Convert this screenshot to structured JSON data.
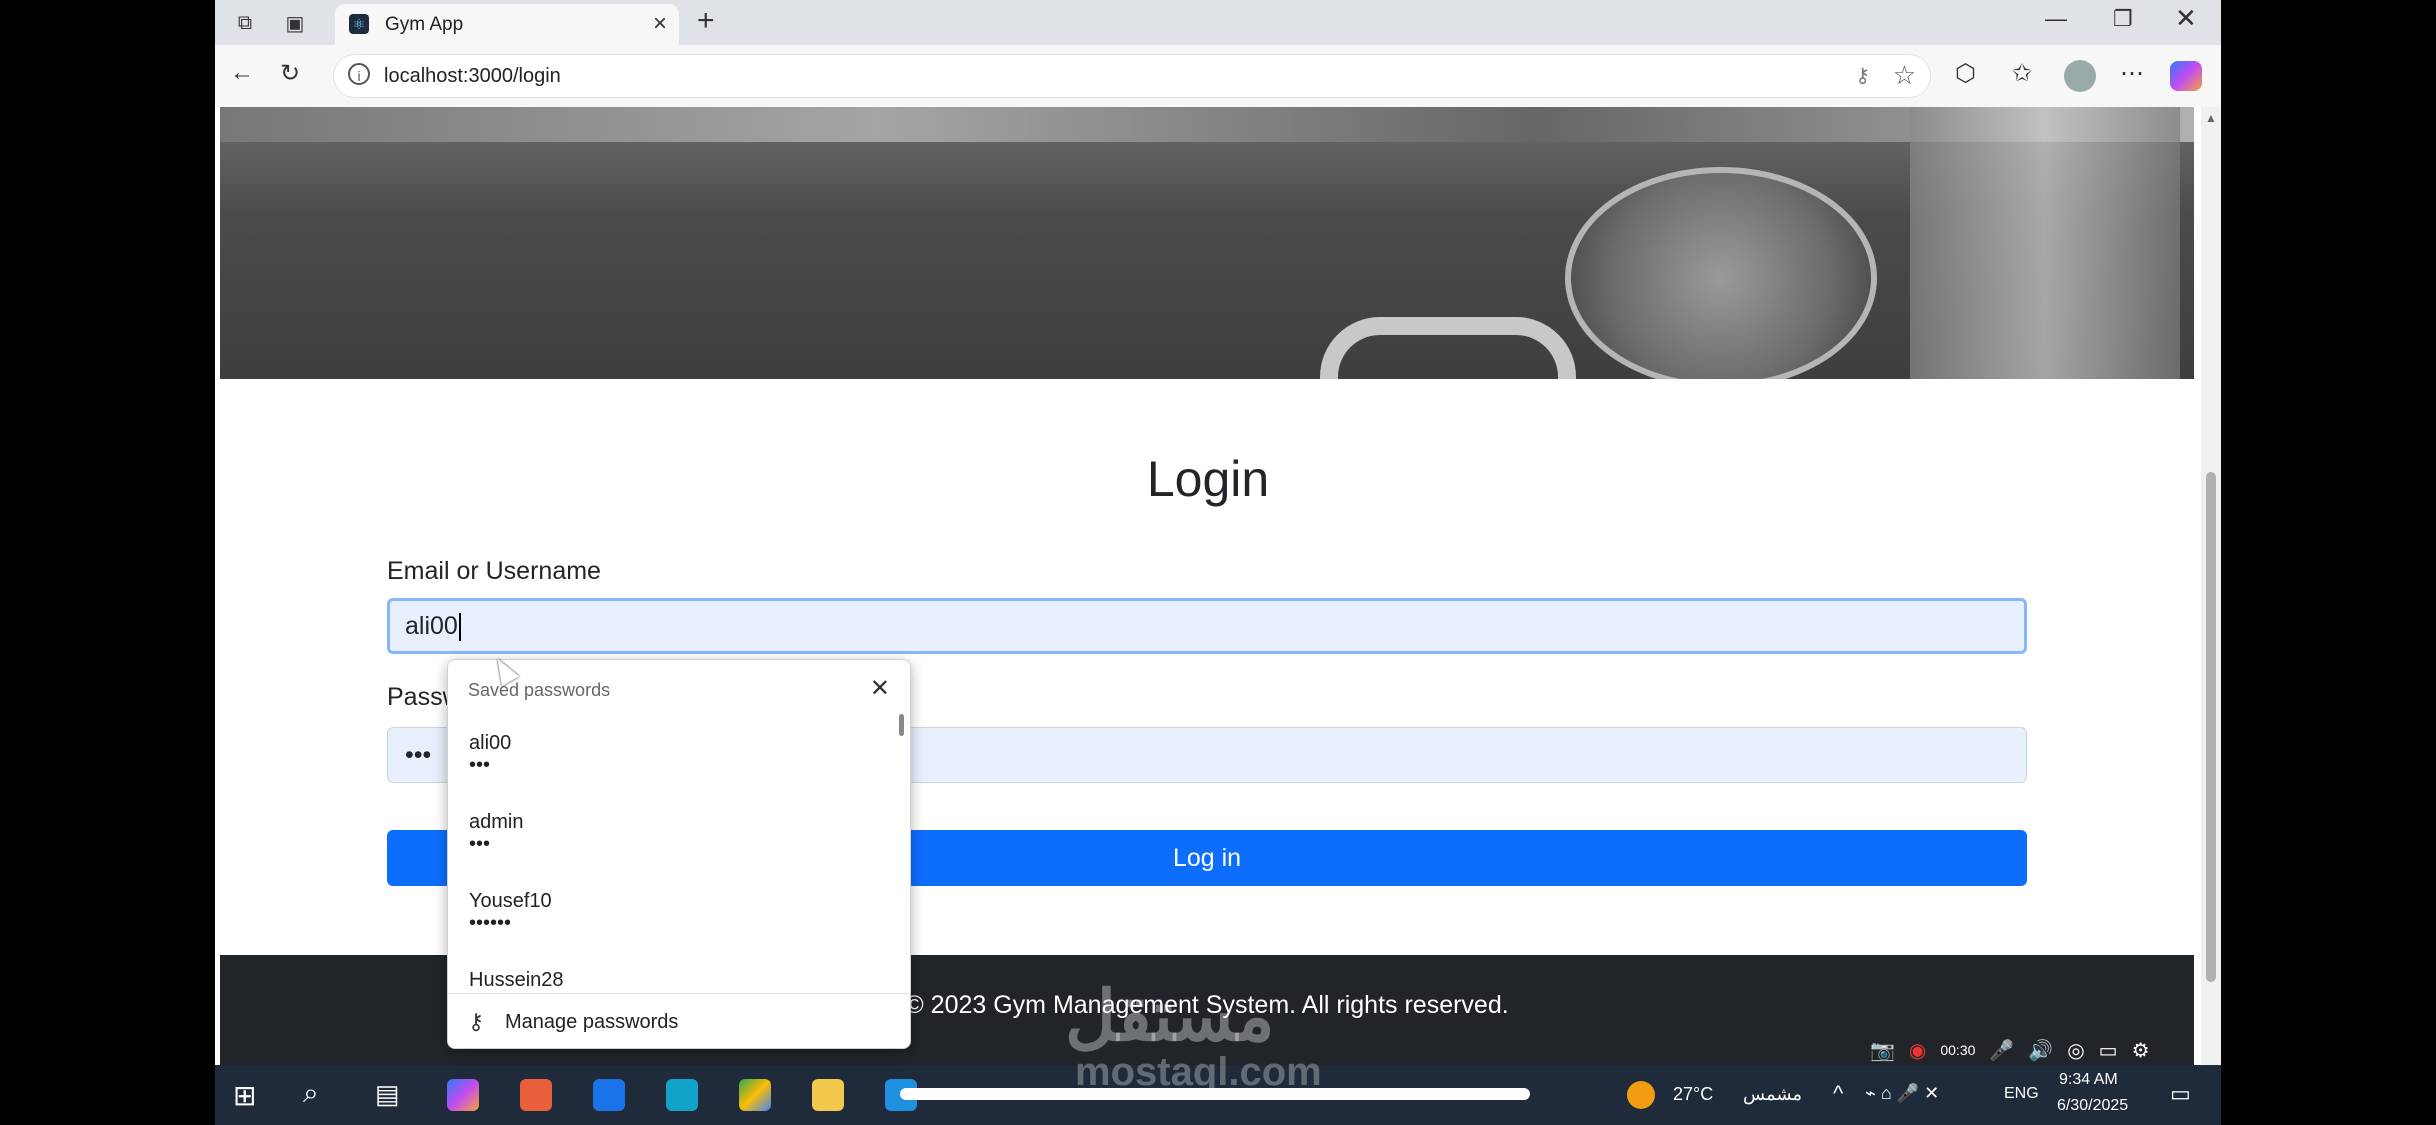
{
  "browser": {
    "tab_title": "Gym App",
    "url": "localhost:3000/login"
  },
  "page": {
    "heading": "Login",
    "email_label": "Email or Username",
    "email_value": "ali00",
    "password_label": "Passw",
    "password_value": "•••",
    "login_button": "Log in",
    "footer": "© 2023 Gym Management System. All rights reserved."
  },
  "autofill": {
    "header": "Saved passwords",
    "items": [
      {
        "username": "ali00",
        "password": "•••"
      },
      {
        "username": "admin",
        "password": "•••"
      },
      {
        "username": "Yousef10",
        "password": "••••••"
      },
      {
        "username": "Hussein28",
        "password": ""
      }
    ],
    "manage_label": "Manage passwords"
  },
  "recorder": {
    "time": "00:30"
  },
  "taskbar": {
    "weather_temp": "27°C",
    "weather_text": "مشمس",
    "language": "ENG",
    "time": "9:34 AM",
    "date": "6/30/2025"
  },
  "watermark": {
    "arabic": "مستقل",
    "latin": "mostaql.com"
  },
  "colors": {
    "primary": "#0d6efd",
    "footer_bg": "#212529",
    "input_bg": "#e8f0fe",
    "focus_border": "#86b7fe"
  }
}
